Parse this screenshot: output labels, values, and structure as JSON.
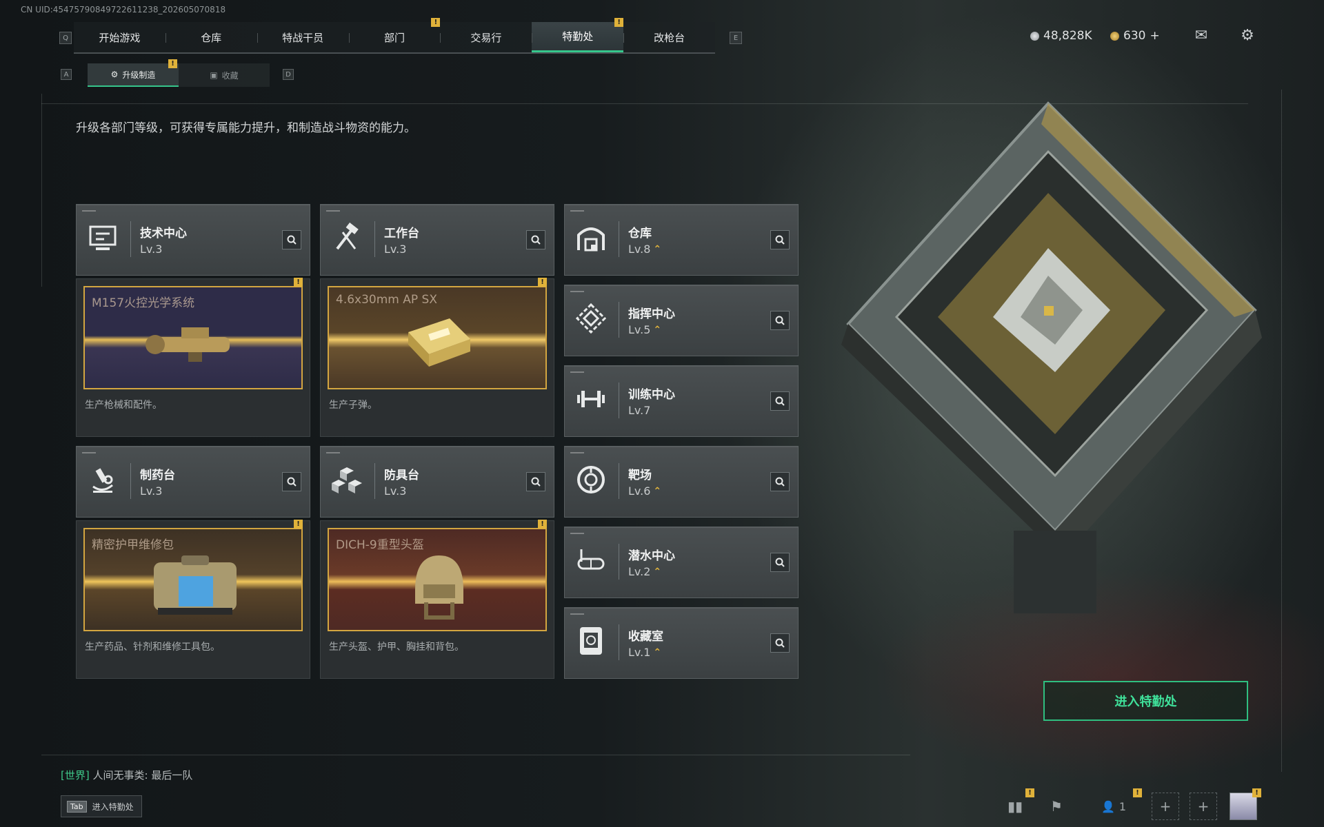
{
  "uid_text": "CN UID:4547579084972261123​8_202605070818",
  "nav": {
    "left_key": "Q",
    "right_key": "E",
    "tabs": [
      {
        "label": "开始游戏"
      },
      {
        "label": "仓库"
      },
      {
        "label": "特战干员"
      },
      {
        "label": "部门"
      },
      {
        "label": "交易行"
      },
      {
        "label": "特勤处"
      },
      {
        "label": "改枪台"
      }
    ]
  },
  "subnav": {
    "left_key": "A",
    "right_key": "D",
    "tabs": [
      {
        "label": "升级制造"
      },
      {
        "label": "收藏"
      }
    ]
  },
  "currency": {
    "silver": "48,828K",
    "gold": "630",
    "gold_plus": "+"
  },
  "description": "升级各部门等级，可获得专属能力提升，和制造战斗物资的能力。",
  "facilities": [
    {
      "name": "技术中心",
      "level": "Lv.3",
      "icon": "tech-center-icon"
    },
    {
      "name": "工作台",
      "level": "Lv.3",
      "icon": "workbench-icon"
    },
    {
      "name": "制药台",
      "level": "Lv.3",
      "icon": "pharmacy-icon"
    },
    {
      "name": "防具台",
      "level": "Lv.3",
      "icon": "armor-bench-icon"
    },
    {
      "name": "仓库",
      "level": "Lv.8",
      "icon": "warehouse-icon"
    },
    {
      "name": "指挥中心",
      "level": "Lv.5",
      "icon": "command-center-icon"
    },
    {
      "name": "训练中心",
      "level": "Lv.7",
      "icon": "training-center-icon"
    },
    {
      "name": "靶场",
      "level": "Lv.6",
      "icon": "shooting-range-icon"
    },
    {
      "name": "潜水中心",
      "level": "Lv.2",
      "icon": "diving-center-icon"
    },
    {
      "name": "收藏室",
      "level": "Lv.1",
      "icon": "collection-room-icon"
    }
  ],
  "productions": [
    {
      "title": "M157火控光学系统",
      "desc": "生产枪械和配件。",
      "colors": [
        "#2e2c48",
        "#d9a948"
      ]
    },
    {
      "title": "4.6x30mm AP SX",
      "desc": "生产子弹。",
      "colors": [
        "#4a3826",
        "#e4b64e"
      ]
    },
    {
      "title": "精密护甲维修包",
      "desc": "生产药品、针剂和维修工具包。",
      "colors": [
        "#3d3124",
        "#e0b048"
      ]
    },
    {
      "title": "DICH-9重型头盔",
      "desc": "生产头盔、护甲、胸挂和背包。",
      "colors": [
        "#4e2a24",
        "#d79a42"
      ]
    }
  ],
  "enter_button": "进入特勤处",
  "chat": {
    "channel": "[世界]",
    "message": "人间无事类: 最后一队"
  },
  "tab_hint": {
    "key": "Tab",
    "label": "进入特勤处"
  },
  "bottom_bar": {
    "squad_count": "1"
  },
  "accent_colors": {
    "green": "#36c68c",
    "gold": "#e0b23a"
  }
}
